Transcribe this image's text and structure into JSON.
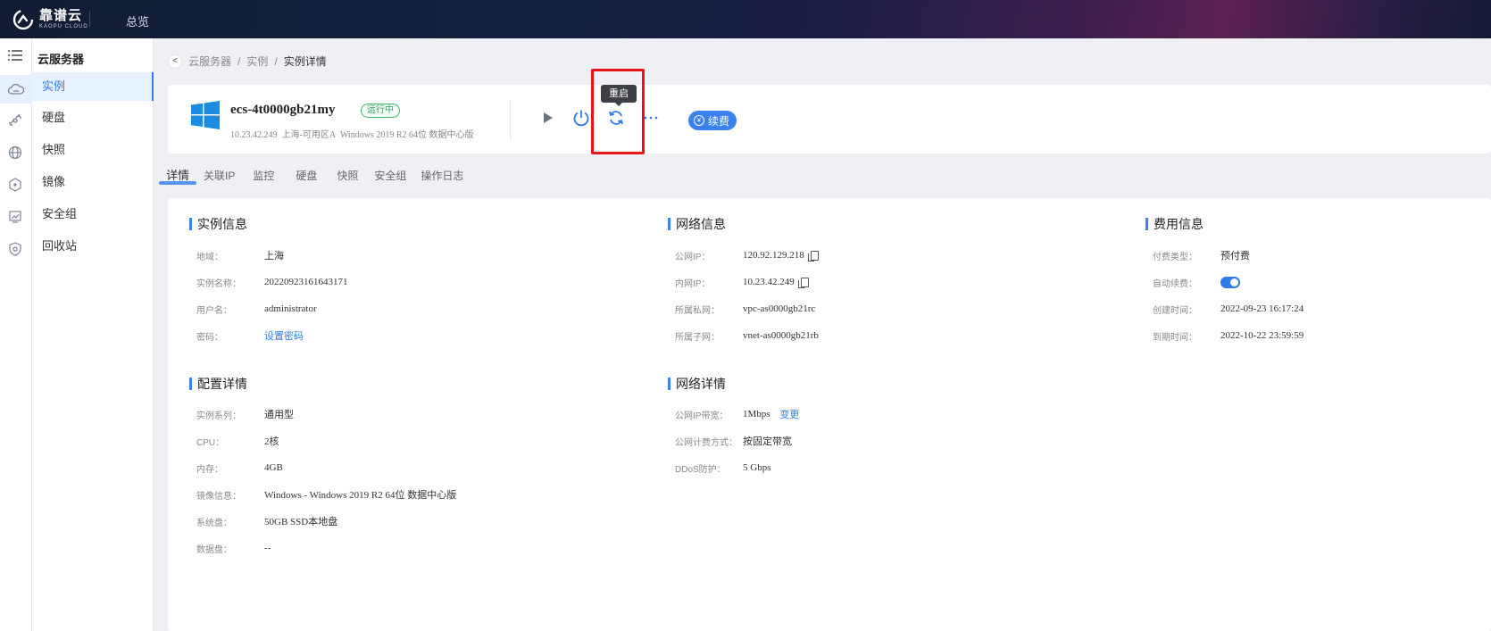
{
  "topbar": {
    "logo_cn": "靠谱云",
    "logo_en": "KAOPU CLOUD",
    "nav_label": "总览"
  },
  "sidebar": {
    "title": "云服务器",
    "items": [
      {
        "label": "实例",
        "active": true
      },
      {
        "label": "硬盘"
      },
      {
        "label": "快照"
      },
      {
        "label": "镜像"
      },
      {
        "label": "安全组"
      },
      {
        "label": "回收站"
      }
    ]
  },
  "breadcrumb": {
    "back": "<",
    "items": [
      "云服务器",
      "实例",
      "实例详情"
    ],
    "separator": "/"
  },
  "instance": {
    "name": "ecs-4t0000gb21my",
    "status": "运行中",
    "ip": "10.23.42.249",
    "zone": "上海-可用区A",
    "os": "Windows 2019 R2 64位 数据中心版",
    "actions": {
      "start": "start",
      "power": "power",
      "restart": "restart",
      "more": "more",
      "renew_label": "续费"
    },
    "tooltip": "重启"
  },
  "tabs": [
    "详情",
    "关联IP",
    "监控",
    "硬盘",
    "快照",
    "安全组",
    "操作日志"
  ],
  "sections": {
    "instance_info": {
      "title": "实例信息",
      "rows": [
        {
          "k": "地域：",
          "v": "上海"
        },
        {
          "k": "实例名称：",
          "v": "20220923161643171"
        },
        {
          "k": "用户名：",
          "v": "administrator"
        },
        {
          "k": "密码：",
          "v": "设置密码"
        }
      ]
    },
    "network_info": {
      "title": "网络信息",
      "rows": [
        {
          "k": "公网IP：",
          "v": "120.92.129.218"
        },
        {
          "k": "内网IP：",
          "v": "10.23.42.249"
        },
        {
          "k": "所属私网：",
          "v": "vpc-as0000gb21rc"
        },
        {
          "k": "所属子网：",
          "v": "vnet-as0000gb21rb"
        }
      ]
    },
    "fee_info": {
      "title": "费用信息",
      "rows": [
        {
          "k": "付费类型：",
          "v": "预付费"
        },
        {
          "k": "自动续费：",
          "v": ""
        },
        {
          "k": "创建时间：",
          "v": "2022-09-23 16:17:24"
        },
        {
          "k": "到期时间：",
          "v": "2022-10-22 23:59:59"
        }
      ]
    },
    "config_detail": {
      "title": "配置详情",
      "rows": [
        {
          "k": "实例系列：",
          "v": "通用型"
        },
        {
          "k": "CPU：",
          "v": "2核"
        },
        {
          "k": "内存：",
          "v": "4GB"
        },
        {
          "k": "镜像信息：",
          "v": "Windows - Windows 2019 R2 64位 数据中心版"
        },
        {
          "k": "系统盘：",
          "v": "50GB SSD本地盘"
        },
        {
          "k": "数据盘：",
          "v": "--"
        }
      ]
    },
    "network_detail": {
      "title": "网络详情",
      "rows": [
        {
          "k": "公网IP带宽：",
          "v": "1Mbps",
          "link": "变更"
        },
        {
          "k": "公网计费方式：",
          "v": "按固定带宽"
        },
        {
          "k": "DDoS防护：",
          "v": "5 Gbps"
        }
      ]
    }
  },
  "colors": {
    "accent": "#3b82f0",
    "status_green": "#34a35d",
    "highlight_red": "#e8151a"
  }
}
